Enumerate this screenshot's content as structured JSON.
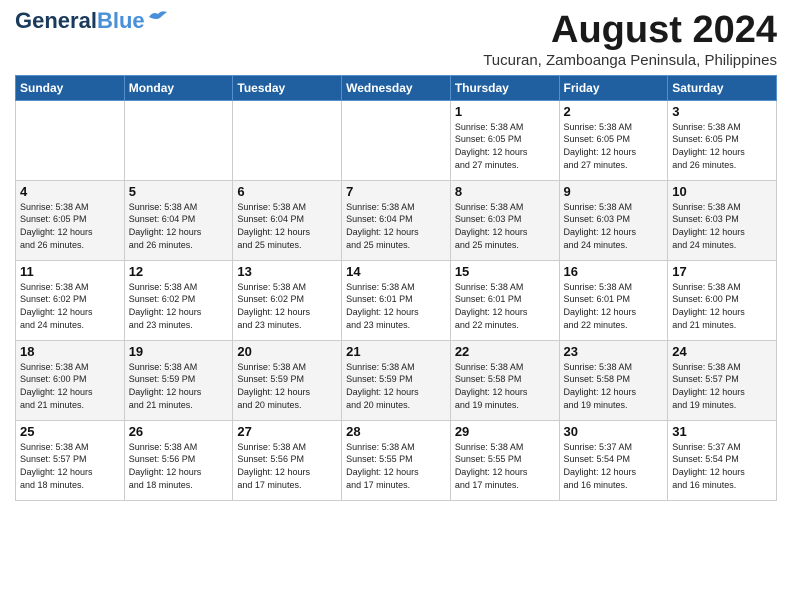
{
  "header": {
    "logo_line1": "General",
    "logo_line2": "Blue",
    "main_title": "August 2024",
    "subtitle": "Tucuran, Zamboanga Peninsula, Philippines"
  },
  "weekdays": [
    "Sunday",
    "Monday",
    "Tuesday",
    "Wednesday",
    "Thursday",
    "Friday",
    "Saturday"
  ],
  "weeks": [
    [
      {
        "day": "",
        "info": ""
      },
      {
        "day": "",
        "info": ""
      },
      {
        "day": "",
        "info": ""
      },
      {
        "day": "",
        "info": ""
      },
      {
        "day": "1",
        "info": "Sunrise: 5:38 AM\nSunset: 6:05 PM\nDaylight: 12 hours\nand 27 minutes."
      },
      {
        "day": "2",
        "info": "Sunrise: 5:38 AM\nSunset: 6:05 PM\nDaylight: 12 hours\nand 27 minutes."
      },
      {
        "day": "3",
        "info": "Sunrise: 5:38 AM\nSunset: 6:05 PM\nDaylight: 12 hours\nand 26 minutes."
      }
    ],
    [
      {
        "day": "4",
        "info": "Sunrise: 5:38 AM\nSunset: 6:05 PM\nDaylight: 12 hours\nand 26 minutes."
      },
      {
        "day": "5",
        "info": "Sunrise: 5:38 AM\nSunset: 6:04 PM\nDaylight: 12 hours\nand 26 minutes."
      },
      {
        "day": "6",
        "info": "Sunrise: 5:38 AM\nSunset: 6:04 PM\nDaylight: 12 hours\nand 25 minutes."
      },
      {
        "day": "7",
        "info": "Sunrise: 5:38 AM\nSunset: 6:04 PM\nDaylight: 12 hours\nand 25 minutes."
      },
      {
        "day": "8",
        "info": "Sunrise: 5:38 AM\nSunset: 6:03 PM\nDaylight: 12 hours\nand 25 minutes."
      },
      {
        "day": "9",
        "info": "Sunrise: 5:38 AM\nSunset: 6:03 PM\nDaylight: 12 hours\nand 24 minutes."
      },
      {
        "day": "10",
        "info": "Sunrise: 5:38 AM\nSunset: 6:03 PM\nDaylight: 12 hours\nand 24 minutes."
      }
    ],
    [
      {
        "day": "11",
        "info": "Sunrise: 5:38 AM\nSunset: 6:02 PM\nDaylight: 12 hours\nand 24 minutes."
      },
      {
        "day": "12",
        "info": "Sunrise: 5:38 AM\nSunset: 6:02 PM\nDaylight: 12 hours\nand 23 minutes."
      },
      {
        "day": "13",
        "info": "Sunrise: 5:38 AM\nSunset: 6:02 PM\nDaylight: 12 hours\nand 23 minutes."
      },
      {
        "day": "14",
        "info": "Sunrise: 5:38 AM\nSunset: 6:01 PM\nDaylight: 12 hours\nand 23 minutes."
      },
      {
        "day": "15",
        "info": "Sunrise: 5:38 AM\nSunset: 6:01 PM\nDaylight: 12 hours\nand 22 minutes."
      },
      {
        "day": "16",
        "info": "Sunrise: 5:38 AM\nSunset: 6:01 PM\nDaylight: 12 hours\nand 22 minutes."
      },
      {
        "day": "17",
        "info": "Sunrise: 5:38 AM\nSunset: 6:00 PM\nDaylight: 12 hours\nand 21 minutes."
      }
    ],
    [
      {
        "day": "18",
        "info": "Sunrise: 5:38 AM\nSunset: 6:00 PM\nDaylight: 12 hours\nand 21 minutes."
      },
      {
        "day": "19",
        "info": "Sunrise: 5:38 AM\nSunset: 5:59 PM\nDaylight: 12 hours\nand 21 minutes."
      },
      {
        "day": "20",
        "info": "Sunrise: 5:38 AM\nSunset: 5:59 PM\nDaylight: 12 hours\nand 20 minutes."
      },
      {
        "day": "21",
        "info": "Sunrise: 5:38 AM\nSunset: 5:59 PM\nDaylight: 12 hours\nand 20 minutes."
      },
      {
        "day": "22",
        "info": "Sunrise: 5:38 AM\nSunset: 5:58 PM\nDaylight: 12 hours\nand 19 minutes."
      },
      {
        "day": "23",
        "info": "Sunrise: 5:38 AM\nSunset: 5:58 PM\nDaylight: 12 hours\nand 19 minutes."
      },
      {
        "day": "24",
        "info": "Sunrise: 5:38 AM\nSunset: 5:57 PM\nDaylight: 12 hours\nand 19 minutes."
      }
    ],
    [
      {
        "day": "25",
        "info": "Sunrise: 5:38 AM\nSunset: 5:57 PM\nDaylight: 12 hours\nand 18 minutes."
      },
      {
        "day": "26",
        "info": "Sunrise: 5:38 AM\nSunset: 5:56 PM\nDaylight: 12 hours\nand 18 minutes."
      },
      {
        "day": "27",
        "info": "Sunrise: 5:38 AM\nSunset: 5:56 PM\nDaylight: 12 hours\nand 17 minutes."
      },
      {
        "day": "28",
        "info": "Sunrise: 5:38 AM\nSunset: 5:55 PM\nDaylight: 12 hours\nand 17 minutes."
      },
      {
        "day": "29",
        "info": "Sunrise: 5:38 AM\nSunset: 5:55 PM\nDaylight: 12 hours\nand 17 minutes."
      },
      {
        "day": "30",
        "info": "Sunrise: 5:37 AM\nSunset: 5:54 PM\nDaylight: 12 hours\nand 16 minutes."
      },
      {
        "day": "31",
        "info": "Sunrise: 5:37 AM\nSunset: 5:54 PM\nDaylight: 12 hours\nand 16 minutes."
      }
    ]
  ]
}
